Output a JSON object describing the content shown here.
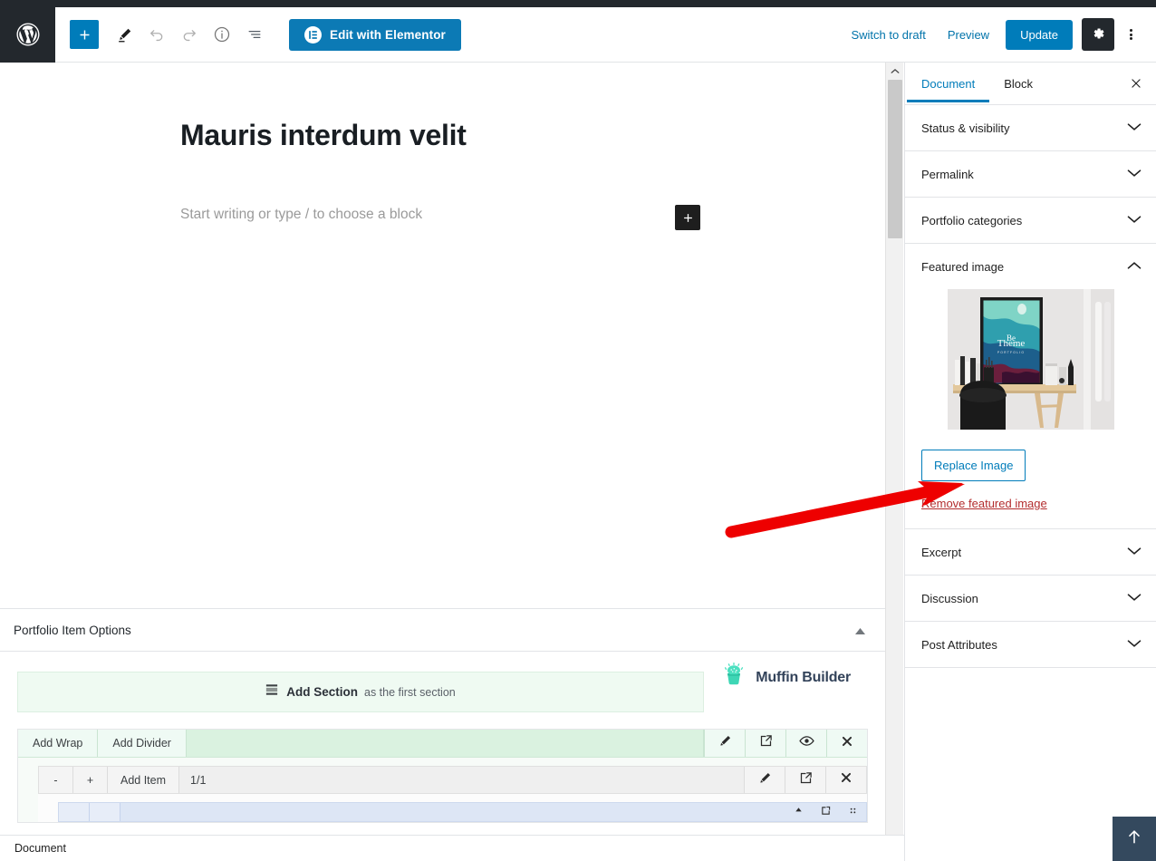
{
  "colors": {
    "wp_blue": "#007cba",
    "elementor_blue": "#0c7ab5",
    "dark": "#23282d",
    "link": "#0073aa",
    "danger": "#b32d2e",
    "annotation_red": "#ee0000",
    "muffin_teal": "#3ed6b5",
    "muffin_navy": "#33435a",
    "section_green": "#daf2e0",
    "wrap_gray": "#efefef",
    "item_blue": "#dde6f5",
    "scrolltop_navy": "#34495e"
  },
  "header": {
    "logo_icon": "wordpress-icon",
    "tools": [
      {
        "name": "add-block-button",
        "icon": "plus-icon",
        "label": "Add block",
        "state": "active"
      },
      {
        "name": "edit-mode-button",
        "icon": "pencil-icon",
        "label": "Tools",
        "state": "enabled"
      },
      {
        "name": "undo-button",
        "icon": "undo-icon",
        "label": "Undo",
        "state": "disabled"
      },
      {
        "name": "redo-button",
        "icon": "redo-icon",
        "label": "Redo",
        "state": "disabled"
      },
      {
        "name": "details-button",
        "icon": "info-icon",
        "label": "Details",
        "state": "enabled"
      },
      {
        "name": "list-view-button",
        "icon": "list-view-icon",
        "label": "List view",
        "state": "enabled"
      }
    ],
    "elementor_button": {
      "label": "Edit with Elementor",
      "icon": "elementor-icon"
    },
    "switch_to_draft": "Switch to draft",
    "preview": "Preview",
    "update": "Update",
    "settings_icon": "gear-icon",
    "more_icon": "kebab-menu-icon"
  },
  "editor": {
    "post_title": "Mauris interdum velit",
    "block_placeholder": "Start writing or type / to choose a block",
    "inserter_icon": "plus-icon"
  },
  "metabox": {
    "title": "Portfolio Item Options",
    "collapse_icon": "caret-up-icon",
    "add_section": {
      "icon": "section-icon",
      "strong": "Add Section",
      "light": "as the first section"
    },
    "brand": {
      "name": "Muffin Builder",
      "icon": "muffin-cupcake-icon"
    },
    "rows": {
      "section": {
        "cells": [
          "Add Wrap",
          "Add Divider"
        ],
        "icons": [
          "edit-pencil-icon",
          "clone-icon",
          "visibility-eye-icon",
          "delete-x-icon"
        ]
      },
      "wrap": {
        "minus": "-",
        "plus": "+",
        "add_item": "Add Item",
        "ratio": "1/1",
        "icons": [
          "edit-pencil-icon",
          "clone-icon",
          "delete-x-icon"
        ]
      },
      "item": {
        "icons": [
          "move-up-icon",
          "clone-icon",
          "drag-handle-icon"
        ]
      }
    }
  },
  "scrollbar": {
    "up_icon": "chevron-up-icon",
    "down_icon": "chevron-down-icon",
    "thumb": "scrollbar-thumb"
  },
  "sidebar": {
    "tabs": [
      {
        "label": "Document",
        "active": true
      },
      {
        "label": "Block",
        "active": false
      }
    ],
    "close_icon": "close-x-icon",
    "panels": [
      {
        "label": "Status & visibility",
        "open": false,
        "icon": "chevron-down-icon"
      },
      {
        "label": "Permalink",
        "open": false,
        "icon": "chevron-down-icon"
      },
      {
        "label": "Portfolio categories",
        "open": false,
        "icon": "chevron-down-icon"
      },
      {
        "label": "Featured image",
        "open": true,
        "icon": "chevron-up-icon"
      },
      {
        "label": "Excerpt",
        "open": false,
        "icon": "chevron-down-icon"
      },
      {
        "label": "Discussion",
        "open": false,
        "icon": "chevron-down-icon"
      },
      {
        "label": "Post Attributes",
        "open": false,
        "icon": "chevron-down-icon"
      }
    ],
    "featured_image": {
      "thumb_name": "featured-image-thumbnail",
      "poster_line1": "Be",
      "poster_line2": "Theme",
      "replace_label": "Replace Image",
      "remove_label": "Remove featured image"
    }
  },
  "annotation": {
    "name": "red-arrow-annotation",
    "points_to": "Remove featured image"
  },
  "bottom": {
    "breadcrumb": "Document",
    "scroll_top_icon": "arrow-up-icon"
  }
}
